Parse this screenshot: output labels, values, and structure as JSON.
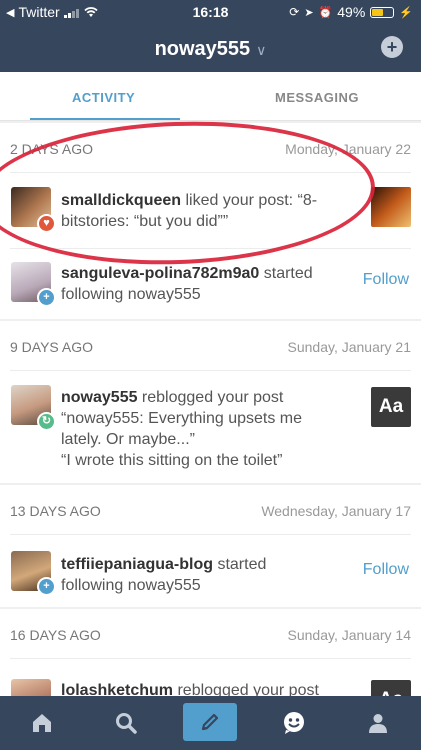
{
  "status_bar": {
    "back_app": "Twitter",
    "time": "16:18",
    "battery_percent": "49%",
    "battery_level": 0.49
  },
  "header": {
    "title": "noway555"
  },
  "tabs": [
    {
      "label": "ACTIVITY",
      "active": true
    },
    {
      "label": "MESSAGING",
      "active": false
    }
  ],
  "sections": [
    {
      "ago": "2 DAYS AGO",
      "date": "Monday, January 22",
      "items": [
        {
          "user": "smalldickqueen",
          "action_line1": " liked your post: “8-",
          "action_line2": "bitstories: “but you did””",
          "badge": "heart-icon"
        },
        {
          "user": "sanguleva-polina782m9a0",
          "action_line1": " started",
          "action_line2": "following noway555",
          "button": "Follow",
          "badge": "plus-icon"
        }
      ]
    },
    {
      "ago": "9 DAYS AGO",
      "date": "Sunday, January 21",
      "items": [
        {
          "user": "noway555",
          "action_line1": " reblogged your post",
          "quote_line1": "“noway555: Everything upsets me",
          "quote_line2": "lately. Or maybe...”",
          "quote_line3": "“I wrote this sitting on the toilet”",
          "thumb_text": "Aa",
          "badge": "reblog-icon"
        }
      ]
    },
    {
      "ago": "13 DAYS AGO",
      "date": "Wednesday, January 17",
      "items": [
        {
          "user": "teffiiepaniagua-blog",
          "action_line1": " started",
          "action_line2": "following noway555",
          "button": "Follow",
          "badge": "plus-icon"
        }
      ]
    },
    {
      "ago": "16 DAYS AGO",
      "date": "Sunday, January 14",
      "items": [
        {
          "user": "lolashketchum",
          "action_line1": " reblogged your post",
          "thumb_text": "Aa"
        }
      ]
    }
  ],
  "colors": {
    "header_bg": "#36465d",
    "accent": "#529ecc",
    "annotation": "#d9243a",
    "like_badge": "#e0573c",
    "follow_badge": "#529ecc",
    "reblog_badge": "#56bc8a"
  },
  "bottom_nav": [
    "home-icon",
    "search-icon",
    "pencil-icon",
    "activity-smiley-icon",
    "account-icon"
  ]
}
